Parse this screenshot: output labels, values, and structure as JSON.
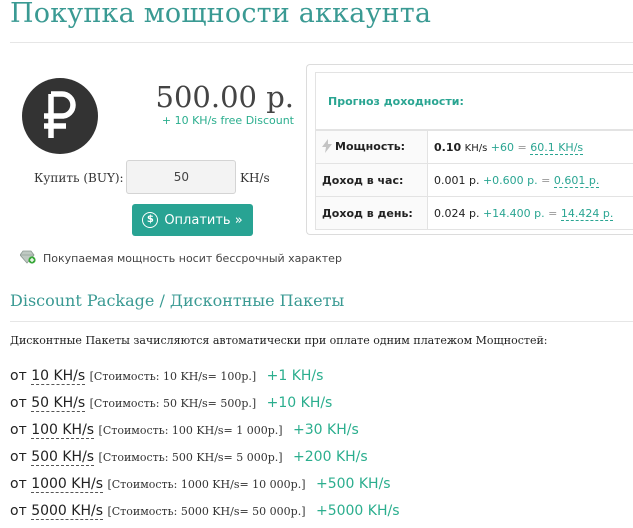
{
  "page": {
    "title": "Покупка мощности аккаунта"
  },
  "purchase": {
    "price": "500.00 р.",
    "discount_note": "+ 10 KH/s free Discount",
    "buy_label": "Купить (BUY):",
    "quantity_value": "50",
    "unit": "KH/s",
    "pay_label": "Оплатить »",
    "permanent_note": "Покупаемая мощность носит бессрочный характер"
  },
  "forecast": {
    "title": "Прогноз доходности:",
    "power": {
      "label": "Мощность:",
      "current": "0.10",
      "unit": "KH/s",
      "plus": "+60",
      "eq": "=",
      "total": "60.1 KH/s"
    },
    "hour": {
      "label": "Доход в час:",
      "current": "0.001 р.",
      "plus": "+0.600 р.",
      "eq": "=",
      "total": "0.601 р."
    },
    "day": {
      "label": "Доход в день:",
      "current": "0.024 р.",
      "plus": "+14.400 р.",
      "eq": "=",
      "total": "14.424 р."
    }
  },
  "discounts": {
    "title": "Discount Package / Дисконтные Пакеты",
    "description": "Дисконтные Пакеты зачисляются автоматически при оплате одним платежом Мощностей:",
    "prefix": "от",
    "packages": [
      {
        "amount": "10 KH/s",
        "cost": "[Стоимость: 10 KH/s= 100р.]",
        "bonus": "+1 KH/s"
      },
      {
        "amount": "50 KH/s",
        "cost": "[Стоимость: 50 KH/s= 500р.]",
        "bonus": "+10 KH/s"
      },
      {
        "amount": "100 KH/s",
        "cost": "[Стоимость: 100 KH/s= 1 000р.]",
        "bonus": "+30 KH/s"
      },
      {
        "amount": "500 KH/s",
        "cost": "[Стоимость: 500 KH/s= 5 000р.]",
        "bonus": "+200 KH/s"
      },
      {
        "amount": "1000 KH/s",
        "cost": "[Стоимость: 1000 KH/s= 10 000р.]",
        "bonus": "+500 KH/s"
      },
      {
        "amount": "5000 KH/s",
        "cost": "[Стоимость: 5000 KH/s= 50 000р.]",
        "bonus": "+5000 KH/s"
      }
    ]
  },
  "icons": {
    "logo": "ruble-logo",
    "pay": "coin-icon",
    "permanent": "diamond-plus-icon",
    "power": "lightning-icon"
  },
  "colors": {
    "accent": "#3a9a93",
    "button": "#28a393",
    "bonus": "#2bae8e"
  }
}
